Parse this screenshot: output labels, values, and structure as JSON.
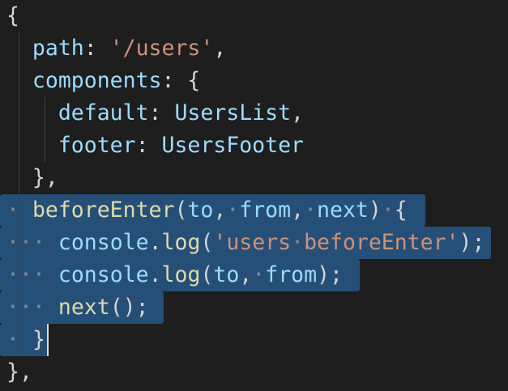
{
  "theme": {
    "background": "#1e1e1e",
    "selection": "#264f78",
    "colors": {
      "punct": "#d4d4d4",
      "property": "#9cdcfe",
      "string": "#ce9178",
      "variable": "#9cdcfe",
      "function": "#dcdcaa",
      "whitespace": "#8a8a8a"
    }
  },
  "code_lines": [
    [
      {
        "t": "{",
        "c": "punct"
      }
    ],
    [
      {
        "t": "  "
      },
      {
        "t": "path",
        "c": "property"
      },
      {
        "t": ": ",
        "c": "punct"
      },
      {
        "t": "'/users'",
        "c": "string"
      },
      {
        "t": ",",
        "c": "punct"
      }
    ],
    [
      {
        "t": "  "
      },
      {
        "t": "components",
        "c": "property"
      },
      {
        "t": ": {",
        "c": "punct"
      }
    ],
    [
      {
        "t": "    "
      },
      {
        "t": "default",
        "c": "property"
      },
      {
        "t": ": ",
        "c": "punct"
      },
      {
        "t": "UsersList",
        "c": "variable"
      },
      {
        "t": ",",
        "c": "punct"
      }
    ],
    [
      {
        "t": "    "
      },
      {
        "t": "footer",
        "c": "property"
      },
      {
        "t": ": ",
        "c": "punct"
      },
      {
        "t": "UsersFooter",
        "c": "variable"
      }
    ],
    [
      {
        "t": "  "
      },
      {
        "t": "},",
        "c": "punct"
      }
    ],
    [
      {
        "t": "·",
        "c": "whitespace"
      },
      {
        "t": " "
      },
      {
        "t": "beforeEnter",
        "c": "function"
      },
      {
        "t": "(",
        "c": "punct"
      },
      {
        "t": "to",
        "c": "variable"
      },
      {
        "t": ",",
        "c": "punct"
      },
      {
        "t": "·",
        "c": "whitespace"
      },
      {
        "t": "from",
        "c": "variable"
      },
      {
        "t": ",",
        "c": "punct"
      },
      {
        "t": "·",
        "c": "whitespace"
      },
      {
        "t": "next",
        "c": "variable"
      },
      {
        "t": ")",
        "c": "punct"
      },
      {
        "t": "·",
        "c": "whitespace"
      },
      {
        "t": "{",
        "c": "punct"
      }
    ],
    [
      {
        "t": "·",
        "c": "whitespace"
      },
      {
        "t": "·",
        "c": "whitespace"
      },
      {
        "t": "·",
        "c": "whitespace"
      },
      {
        "t": " "
      },
      {
        "t": "console",
        "c": "variable"
      },
      {
        "t": ".",
        "c": "punct"
      },
      {
        "t": "log",
        "c": "function"
      },
      {
        "t": "(",
        "c": "punct"
      },
      {
        "t": "'users",
        "c": "string"
      },
      {
        "t": "·",
        "c": "whitespace"
      },
      {
        "t": "beforeEnter'",
        "c": "string"
      },
      {
        "t": ");",
        "c": "punct"
      }
    ],
    [
      {
        "t": "·",
        "c": "whitespace"
      },
      {
        "t": "·",
        "c": "whitespace"
      },
      {
        "t": "·",
        "c": "whitespace"
      },
      {
        "t": " "
      },
      {
        "t": "console",
        "c": "variable"
      },
      {
        "t": ".",
        "c": "punct"
      },
      {
        "t": "log",
        "c": "function"
      },
      {
        "t": "(",
        "c": "punct"
      },
      {
        "t": "to",
        "c": "variable"
      },
      {
        "t": ",",
        "c": "punct"
      },
      {
        "t": "·",
        "c": "whitespace"
      },
      {
        "t": "from",
        "c": "variable"
      },
      {
        "t": ");",
        "c": "punct"
      }
    ],
    [
      {
        "t": "·",
        "c": "whitespace"
      },
      {
        "t": "·",
        "c": "whitespace"
      },
      {
        "t": "·",
        "c": "whitespace"
      },
      {
        "t": " "
      },
      {
        "t": "next",
        "c": "function"
      },
      {
        "t": "();",
        "c": "punct"
      }
    ],
    [
      {
        "t": "·",
        "c": "whitespace"
      },
      {
        "t": " "
      },
      {
        "t": "}",
        "c": "punct"
      }
    ],
    [
      {
        "t": "},",
        "c": "punct"
      }
    ]
  ]
}
